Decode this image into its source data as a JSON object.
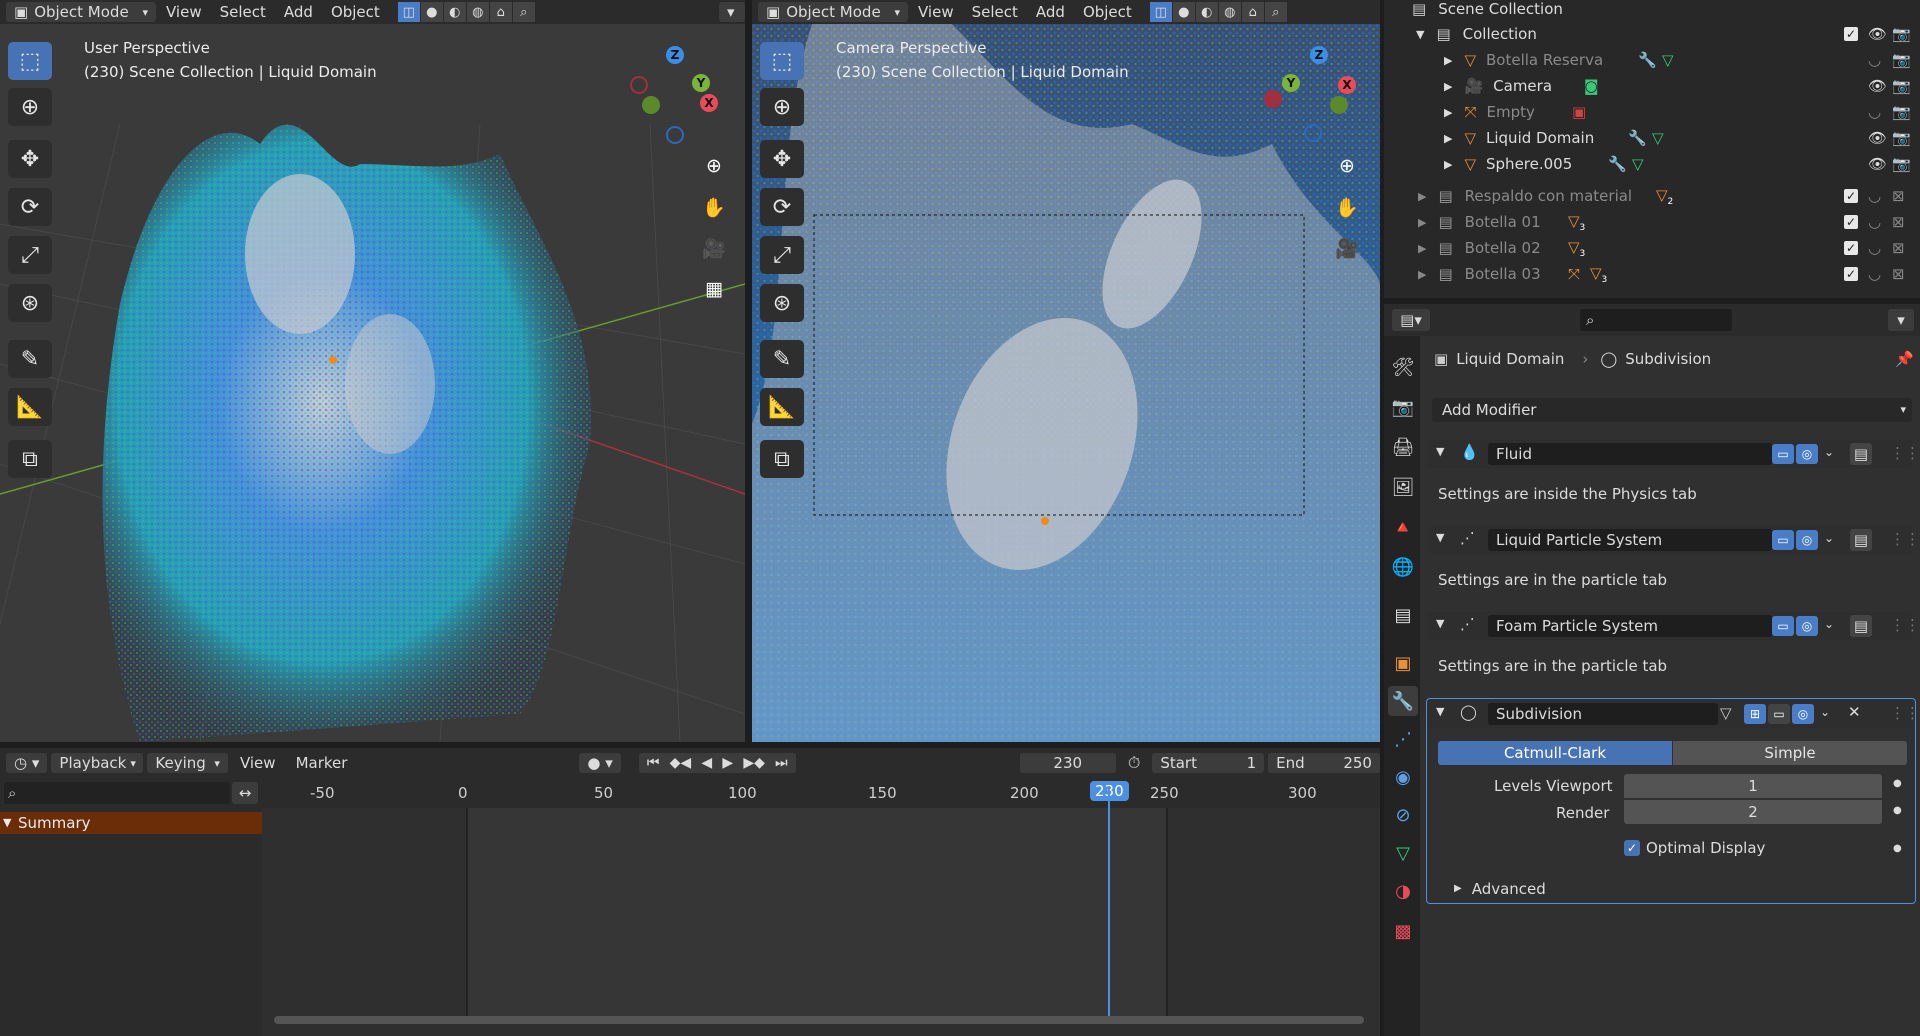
{
  "left_header": {
    "mode": "Object Mode",
    "menus": [
      "View",
      "Select",
      "Add",
      "Object"
    ]
  },
  "right_header": {
    "mode": "Object Mode",
    "menus": [
      "View",
      "Select",
      "Add",
      "Object"
    ]
  },
  "viewport_left": {
    "line1": "User Perspective",
    "line2": "(230) Scene Collection | Liquid Domain"
  },
  "viewport_right": {
    "line1": "Camera Perspective",
    "line2": "(230) Scene Collection | Liquid Domain"
  },
  "gizmo": {
    "z": "Z",
    "y": "Y",
    "x": "X"
  },
  "timeline": {
    "menus": [
      "Playback",
      "Keying",
      "View",
      "Marker"
    ],
    "current_frame": "230",
    "start_label": "Start",
    "start_value": "1",
    "end_label": "End",
    "end_value": "250",
    "ruler": [
      "-50",
      "0",
      "50",
      "100",
      "150",
      "200",
      "230",
      "250",
      "300"
    ],
    "summary": "Summary"
  },
  "outliner": {
    "scene_collection": "Scene Collection",
    "items": [
      {
        "label": "Collection",
        "color": "#dcdcdc"
      },
      {
        "label": "Botella Reserva",
        "color": "#8a8a8a"
      },
      {
        "label": "Camera",
        "color": "#dcdcdc"
      },
      {
        "label": "Empty",
        "color": "#8a8a8a"
      },
      {
        "label": "Liquid Domain",
        "color": "#dcdcdc"
      },
      {
        "label": "Sphere.005",
        "color": "#dcdcdc"
      },
      {
        "label": "Respaldo con material",
        "color": "#8a8a8a",
        "count": "2"
      },
      {
        "label": "Botella 01",
        "color": "#8a8a8a",
        "count": "3"
      },
      {
        "label": "Botella 02",
        "color": "#8a8a8a",
        "count": "3"
      },
      {
        "label": "Botella 03",
        "color": "#8a8a8a",
        "count": "3"
      }
    ]
  },
  "properties": {
    "breadcrumb_object": "Liquid Domain",
    "breadcrumb_modifier": "Subdivision",
    "add_modifier": "Add Modifier",
    "modifiers": [
      {
        "name": "Fluid",
        "note": "Settings are inside the Physics tab"
      },
      {
        "name": "Liquid Particle System",
        "note": "Settings are in the particle tab"
      },
      {
        "name": "Foam Particle System",
        "note": "Settings are in the particle tab"
      }
    ],
    "subdivision": {
      "name": "Subdivision",
      "tab_active": "Catmull-Clark",
      "tab_other": "Simple",
      "levels_label": "Levels Viewport",
      "levels_value": "1",
      "render_label": "Render",
      "render_value": "2",
      "optimal_label": "Optimal Display",
      "advanced_label": "Advanced"
    }
  },
  "colors": {
    "accent": "#4772b3",
    "summary_bg": "#6b2d08",
    "playhead": "#4d8fe0"
  }
}
